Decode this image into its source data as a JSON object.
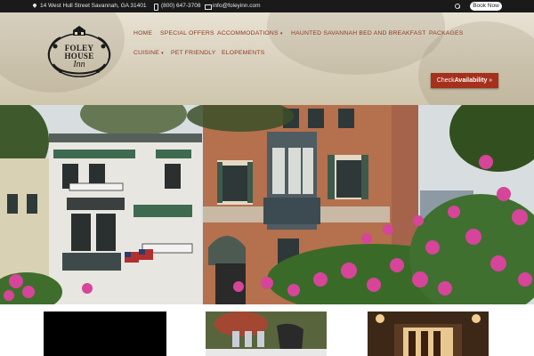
{
  "topbar": {
    "address": "14 West Hull Street Savannah, GA 31401",
    "phone": "(800) 647-3708",
    "email": "info@foleyinn.com",
    "book_label": "Book Now",
    "icons": [
      "pin-icon",
      "phone-icon",
      "mail-icon",
      "search-icon"
    ]
  },
  "logo": {
    "line1": "FOLEY HOUSE",
    "line2": "Inn"
  },
  "nav": {
    "items": [
      {
        "label": "HOME"
      },
      {
        "label": "SPECIAL OFFERS"
      },
      {
        "label": "ACCOMMODATIONS",
        "has_caret": true
      },
      {
        "label": "HAUNTED SAVANNAH BED AND BREAKFAST"
      },
      {
        "label": "PACKAGES"
      },
      {
        "label": "CUISINE",
        "has_caret": true
      },
      {
        "label": "PET FRIENDLY"
      },
      {
        "label": "ELOPEMENTS"
      }
    ]
  },
  "cta": {
    "prefix": "Check",
    "emphasis": "Availability",
    "arrow": "»"
  },
  "colors": {
    "nav_text": "#8a3a1e",
    "cta_bg": "#a5301c",
    "topbar_bg": "#1a1a1a"
  }
}
